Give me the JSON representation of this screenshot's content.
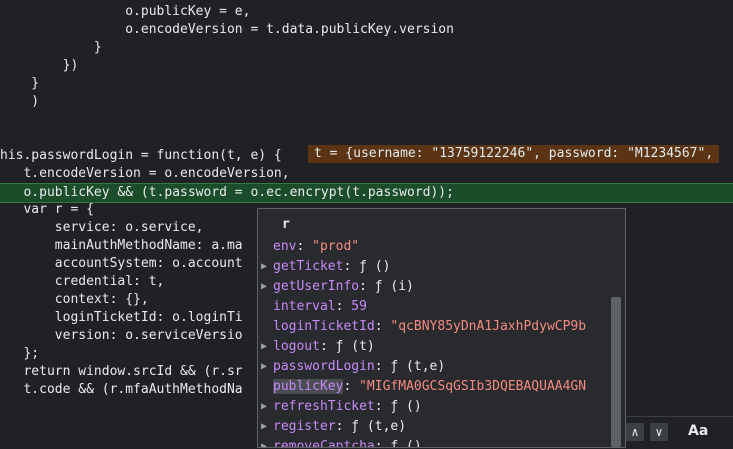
{
  "code_lines": [
    {
      "text": "                o.publicKey = e,"
    },
    {
      "text": "                o.encodeVersion = t.data.publicKey.version"
    },
    {
      "text": "            }"
    },
    {
      "text": "        })"
    },
    {
      "text": "    }"
    },
    {
      "text": "    )"
    },
    {
      "text": ""
    },
    {
      "text": ""
    },
    {
      "text": "his.passwordLogin = function(t, e) {"
    },
    {
      "text": "   t.encodeVersion = o.encodeVersion,"
    },
    {
      "text": "   o.publicKey && (t.password = o.ec.encrypt(t.password));"
    },
    {
      "text": "   var r = {"
    },
    {
      "text": "       service: o.service,"
    },
    {
      "text": "       mainAuthMethodName: a.ma"
    },
    {
      "text": "       accountSystem: o.account"
    },
    {
      "text": "       credential: t,"
    },
    {
      "text": "       context: {},"
    },
    {
      "text": "       loginTicketId: o.loginTi"
    },
    {
      "text": "       version: o.serviceVersio"
    },
    {
      "text": "   };"
    },
    {
      "text": "   return window.srcId && (r.sr"
    },
    {
      "text": "   t.code && (r.mfaAuthMethodNa"
    }
  ],
  "inline_value": "t = {username: \"13759122246\", password: \"M1234567\",",
  "popup": {
    "title": "r",
    "rows": [
      {
        "key": "env",
        "sep": ": ",
        "value": "\"prod\"",
        "type": "str",
        "arrow": false
      },
      {
        "key": "getTicket",
        "sep": ": ",
        "value": "ƒ ()",
        "type": "fn",
        "arrow": true
      },
      {
        "key": "getUserInfo",
        "sep": ": ",
        "value": "ƒ (i)",
        "type": "fn",
        "arrow": true
      },
      {
        "key": "interval",
        "sep": ": ",
        "value": "59",
        "type": "num",
        "arrow": false
      },
      {
        "key": "loginTicketId",
        "sep": ": ",
        "value": "\"qcBNY85yDnA1JaxhPdywCP9b",
        "type": "str",
        "arrow": false
      },
      {
        "key": "logout",
        "sep": ": ",
        "value": "ƒ (t)",
        "type": "fn",
        "arrow": true
      },
      {
        "key": "passwordLogin",
        "sep": ": ",
        "value": "ƒ (t,e)",
        "type": "fn",
        "arrow": true
      },
      {
        "key": "publicKey",
        "sep": ": ",
        "value": "\"MIGfMA0GCSqGSIb3DQEBAQUAA4GN",
        "type": "str",
        "arrow": false,
        "selected": true
      },
      {
        "key": "refreshTicket",
        "sep": ": ",
        "value": "ƒ ()",
        "type": "fn",
        "arrow": true
      },
      {
        "key": "register",
        "sep": ": ",
        "value": "ƒ (t,e)",
        "type": "fn",
        "arrow": true
      },
      {
        "key": "removeCaptcha",
        "sep": ": ",
        "value": "ƒ ()",
        "type": "fn",
        "arrow": true
      }
    ]
  },
  "findbar": {
    "prev": "∧",
    "next": "∨",
    "match_case": "Aa",
    "more": "..."
  }
}
